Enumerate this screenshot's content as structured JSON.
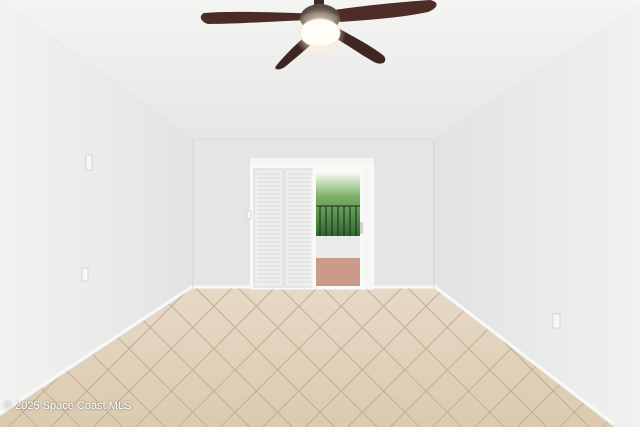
{
  "photo": {
    "watermark": "© 2025 Space Coast MLS"
  }
}
